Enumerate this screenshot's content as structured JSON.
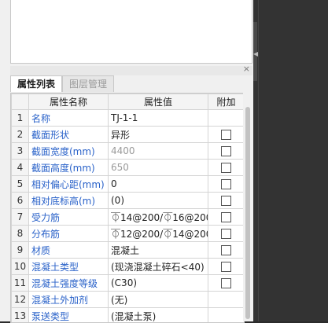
{
  "panel": {
    "close_label": "×",
    "tabs": [
      {
        "label": "属性列表",
        "active": true
      },
      {
        "label": "图层管理",
        "active": false
      }
    ]
  },
  "table": {
    "headers": [
      "属性名称",
      "属性值",
      "附加"
    ],
    "rows": [
      {
        "n": "1",
        "name": "名称",
        "value": "TJ-1-1",
        "check": false,
        "value_gray": false
      },
      {
        "n": "2",
        "name": "截面形状",
        "value": "异形",
        "check": true,
        "value_gray": false
      },
      {
        "n": "3",
        "name": "截面宽度(mm)",
        "value": "4400",
        "check": true,
        "value_gray": true
      },
      {
        "n": "4",
        "name": "截面高度(mm)",
        "value": "650",
        "check": true,
        "value_gray": true
      },
      {
        "n": "5",
        "name": "相对偏心距(mm)",
        "value": "0",
        "check": true,
        "value_gray": false
      },
      {
        "n": "6",
        "name": "相对底标高(m)",
        "value": "(0)",
        "check": true,
        "value_gray": false
      },
      {
        "n": "7",
        "name": "受力筋",
        "value": "⏁14@200/⏁16@200",
        "check": true,
        "value_gray": false
      },
      {
        "n": "8",
        "name": "分布筋",
        "value": "⏁12@200/⏁14@200",
        "check": true,
        "value_gray": false
      },
      {
        "n": "9",
        "name": "材质",
        "value": "混凝土",
        "check": true,
        "value_gray": false
      },
      {
        "n": "10",
        "name": "混凝土类型",
        "value": "(现浇混凝土碎石<40)",
        "check": true,
        "value_gray": false
      },
      {
        "n": "11",
        "name": "混凝土强度等级",
        "value": "(C30)",
        "check": true,
        "value_gray": false
      },
      {
        "n": "12",
        "name": "混凝土外加剂",
        "value": "(无)",
        "check": false,
        "value_gray": false
      },
      {
        "n": "13",
        "name": "泵送类型",
        "value": "(混凝土泵)",
        "check": false,
        "value_gray": false
      }
    ]
  },
  "colors": {
    "link": "#2a62c9",
    "gray_text": "#9a9a9a",
    "canvas": "#333333"
  },
  "icons": {
    "close": "close-icon",
    "collapse": "chevron-left-icon"
  }
}
